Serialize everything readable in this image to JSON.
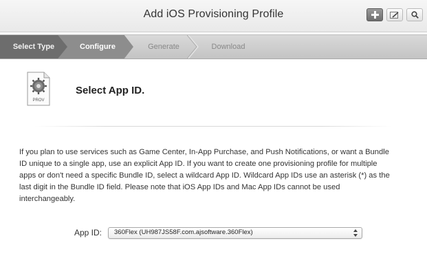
{
  "header": {
    "title": "Add iOS Provisioning Profile",
    "tools": [
      {
        "icon": "plus-icon"
      },
      {
        "icon": "edit-icon"
      },
      {
        "icon": "search-icon"
      }
    ]
  },
  "steps": [
    {
      "label": "Select Type",
      "state": "completed"
    },
    {
      "label": "Configure",
      "state": "current"
    },
    {
      "label": "Generate",
      "state": "upcoming"
    },
    {
      "label": "Download",
      "state": "upcoming"
    }
  ],
  "section": {
    "icon_label": "PROV",
    "title": "Select App ID."
  },
  "description": "If you plan to use services such as Game Center, In-App Purchase, and Push Notifications, or want a Bundle ID unique to a single app, use an explicit App ID. If you want to create one provisioning profile for multiple apps or don't need a specific Bundle ID, select a wildcard App ID. Wildcard App IDs use an asterisk (*) as the last digit in the Bundle ID field. Please note that iOS App IDs and Mac App IDs cannot be used interchangeably.",
  "app_id": {
    "label": "App ID:",
    "selected": "360Flex (UH987JS58F.com.ajsoftware.360Flex)"
  }
}
